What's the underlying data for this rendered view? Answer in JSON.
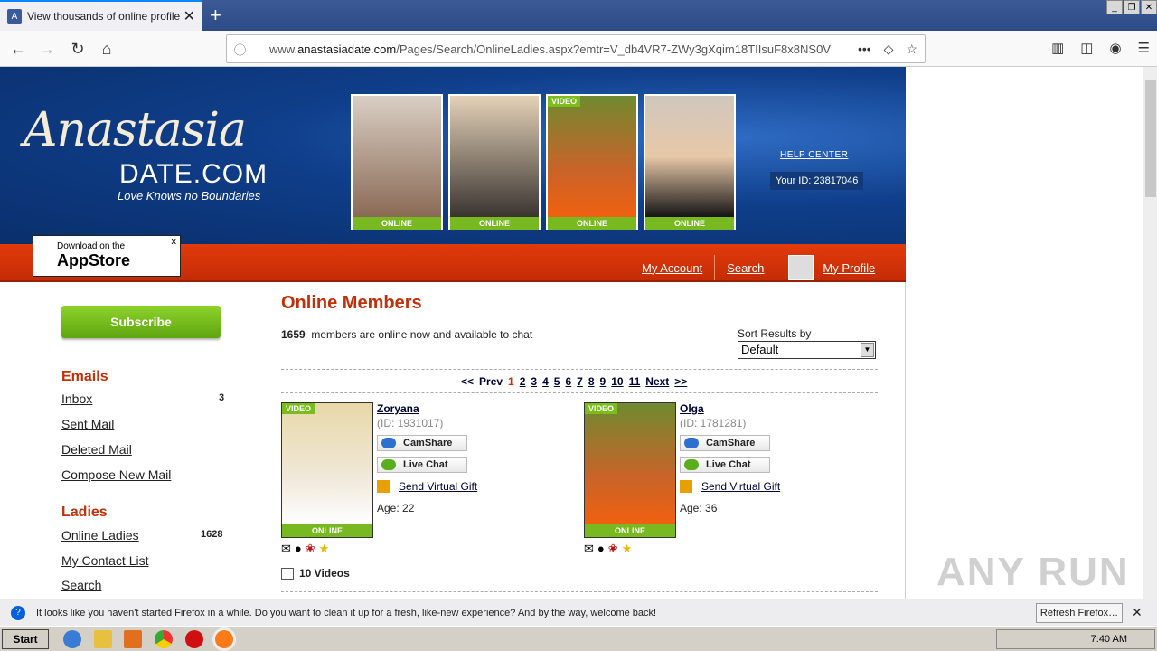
{
  "browser": {
    "tab_title": "View thousands of online profiles f",
    "url_prefix": "www.",
    "url_domain": "anastasiadate.com",
    "url_rest": "/Pages/Search/OnlineLadies.aspx?emtr=V_db4VR7-ZWy3gXqim18TIIsuF8x8NS0V"
  },
  "header": {
    "logo_script": "Anastasia",
    "logo_date": "DATE.COM",
    "tagline": "Love Knows no Boundaries",
    "photos": [
      {
        "status": "ONLINE",
        "badge": ""
      },
      {
        "status": "ONLINE",
        "badge": ""
      },
      {
        "status": "ONLINE",
        "badge": "VIDEO"
      },
      {
        "status": "ONLINE",
        "badge": ""
      }
    ],
    "help_center": "HELP CENTER",
    "your_id": "Your ID: 23817046"
  },
  "appstore": {
    "small": "Download on the",
    "big": "AppStore",
    "close": "x"
  },
  "nav": {
    "my_account": "My Account",
    "search": "Search",
    "my_profile": "My Profile"
  },
  "sidebar": {
    "subscribe": "Subscribe",
    "emails_heading": "Emails",
    "inbox": "Inbox",
    "inbox_count": "3",
    "sent_mail": "Sent Mail",
    "deleted_mail": "Deleted Mail",
    "compose": "Compose New Mail",
    "ladies_heading": "Ladies",
    "online_ladies": "Online Ladies",
    "online_count": "1628",
    "contact_list": "My Contact List",
    "search": "Search"
  },
  "main": {
    "title": "Online Members",
    "member_count": "1659",
    "member_text": "members are online now and available to chat",
    "sort_label": "Sort Results by",
    "sort_value": "Default",
    "pager": {
      "first": "<<",
      "prev": "Prev",
      "pages": [
        "1",
        "2",
        "3",
        "4",
        "5",
        "6",
        "7",
        "8",
        "9",
        "10",
        "11"
      ],
      "next": "Next",
      "last": ">>"
    },
    "members": [
      {
        "name": "Zoryana",
        "id": "(ID: 1931017)",
        "camshare": "CamShare",
        "livechat": "Live Chat",
        "gift": "Send Virtual Gift",
        "age": "Age: 22",
        "badge": "VIDEO",
        "status": "ONLINE"
      },
      {
        "name": "Olga",
        "id": "(ID: 1781281)",
        "camshare": "CamShare",
        "livechat": "Live Chat",
        "gift": "Send Virtual Gift",
        "age": "Age: 36",
        "badge": "VIDEO",
        "status": "ONLINE"
      }
    ],
    "videos": "10 Videos"
  },
  "notification": {
    "text": "It looks like you haven't started Firefox in a while. Do you want to clean it up for a fresh, like-new experience? And by the way, welcome back!",
    "button": "Refresh Firefox…"
  },
  "taskbar": {
    "start": "Start",
    "time": "7:40 AM"
  },
  "watermark": "ANY RUN",
  "colors": {
    "brand_red": "#c0300a",
    "online_green": "#78b820",
    "header_blue": "#0f3e8a"
  }
}
